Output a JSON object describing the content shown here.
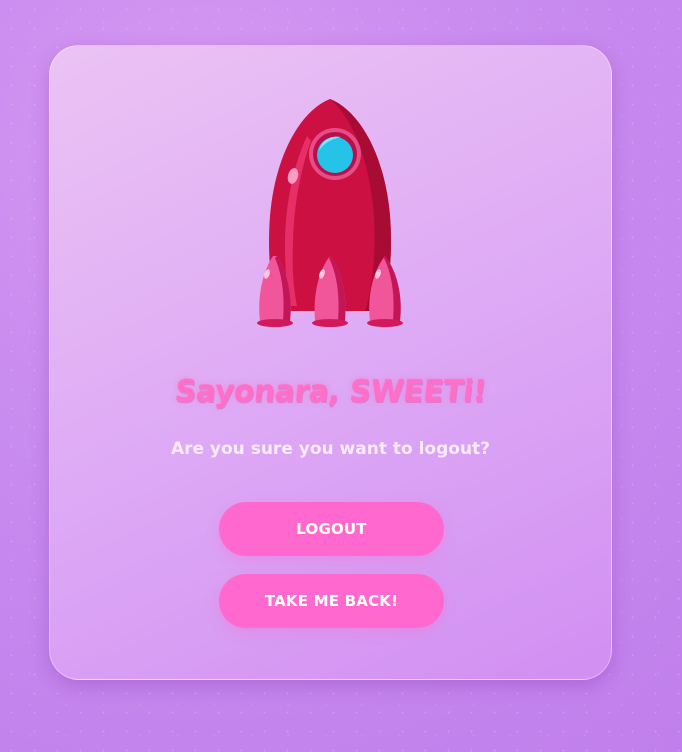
{
  "dialog": {
    "title": "Sayonara, SWEETi!",
    "message": "Are you sure you want to logout?",
    "illustration_icon": "rocket-icon"
  },
  "actions": {
    "logout_label": "LOGOUT",
    "back_label": "TAKE ME BACK!"
  },
  "colors": {
    "background": "#c98cef",
    "card": "#deaaf5",
    "accent_pink": "#ff69cf",
    "title_pink": "#ff6ec7",
    "rocket_body": "#cc1142",
    "rocket_window": "#25c3e8"
  }
}
